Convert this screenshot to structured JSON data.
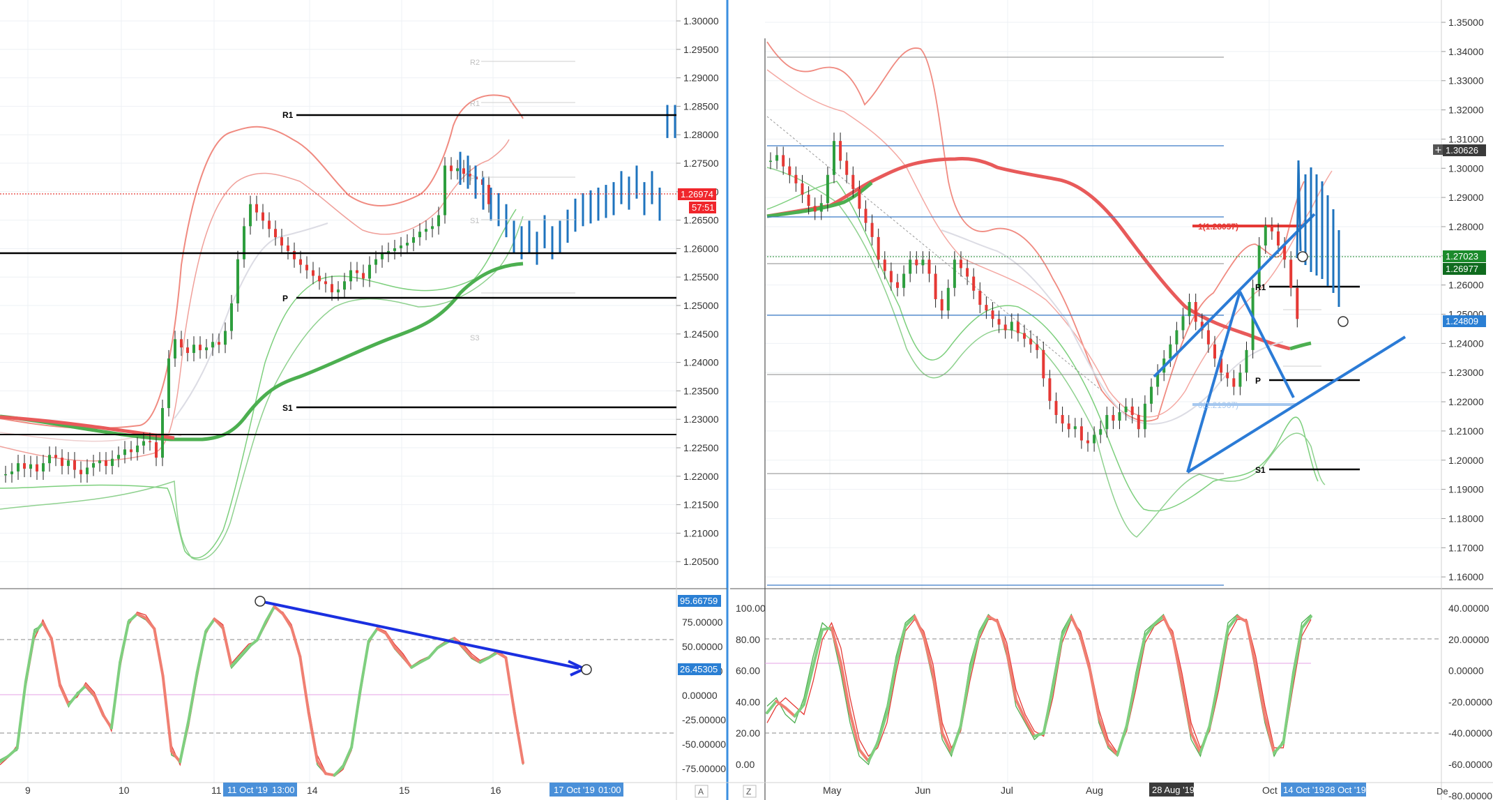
{
  "colors": {
    "up": "#26a69a",
    "up_candle": "#2e9e3e",
    "down": "#e53935",
    "heikin_blue": "#1e73be",
    "bb_upper": "#f08080",
    "bb_lower": "#7ccf7c",
    "ma_red": "#e85a5a",
    "ma_green": "#4caf50",
    "pivot": "#000000",
    "trend_blue": "#2b7bd6",
    "arrow_blue": "#1a2fe0",
    "grid": "#eef1f4",
    "price_tag_red": "#f0262c",
    "price_tag_blue": "#2a7fd4",
    "price_tag_green": "#1b8a2b",
    "stoch_k": "#4caf50",
    "stoch_d": "#e53935",
    "stoch_bold_up": "#7fcf7f",
    "stoch_bold_down": "#f07f72",
    "time_tag": "#4a90d9",
    "date_tag_dark": "#3a3a3a"
  },
  "chart_data": [
    {
      "type": "candlestick",
      "panel": "left-main",
      "y_ticks": [
        "1.30000",
        "1.29500",
        "1.29000",
        "1.28500",
        "1.28000",
        "1.27500",
        "1.27000",
        "1.26500",
        "1.26000",
        "1.25500",
        "1.25000",
        "1.24500",
        "1.24000",
        "1.23500",
        "1.23000",
        "1.22500",
        "1.22000",
        "1.21500",
        "1.21000",
        "1.20500"
      ],
      "ylim": [
        1.2015,
        1.3035
      ],
      "x_ticks": [
        "9",
        "10",
        "11",
        "14",
        "15",
        "16"
      ],
      "price_tags": [
        {
          "label": "1.26974",
          "color": "red"
        },
        {
          "label": "57:51",
          "color": "red"
        }
      ],
      "pivot_levels": [
        {
          "label": "R1",
          "value": 1.2835
        },
        {
          "label": "P",
          "value": 1.2515
        },
        {
          "label": "S1",
          "value": 1.2323
        }
      ],
      "faint_pivots": [
        {
          "label": "R2",
          "value": 1.293
        },
        {
          "label": "R1",
          "value": 1.2855
        },
        {
          "label": "P",
          "value": 1.274
        },
        {
          "label": "S1",
          "value": 1.265
        },
        {
          "label": "S3",
          "value": 1.245
        }
      ],
      "horizontal_lines": [
        1.259,
        1.2275
      ],
      "current_price_line": 1.26974,
      "close_series": [
        1.221,
        1.2215,
        1.223,
        1.222,
        1.2228,
        1.2215,
        1.223,
        1.2245,
        1.224,
        1.2225,
        1.2235,
        1.2218,
        1.221,
        1.2222,
        1.223,
        1.2235,
        1.2225,
        1.2238,
        1.2245,
        1.2255,
        1.225,
        1.2262,
        1.227,
        1.2268,
        1.224,
        1.233,
        1.242,
        1.2455,
        1.244,
        1.243,
        1.2445,
        1.2435,
        1.244,
        1.245,
        1.2445,
        1.247,
        1.252,
        1.26,
        1.266,
        1.27,
        1.2685,
        1.267,
        1.2655,
        1.264,
        1.2625,
        1.2615,
        1.26,
        1.259,
        1.258,
        1.257,
        1.256,
        1.2555,
        1.254,
        1.2545,
        1.256,
        1.258,
        1.2575,
        1.2565,
        1.259,
        1.26,
        1.261,
        1.2615,
        1.262,
        1.2625,
        1.263,
        1.264,
        1.265,
        1.2655,
        1.266,
        1.268,
        1.277,
        1.276,
        1.2765,
        1.2755,
        1.275,
        1.2745,
        1.2735,
        1.27
      ]
    },
    {
      "type": "candlestick",
      "panel": "right-main",
      "y_ticks": [
        "1.35000",
        "1.34000",
        "1.33000",
        "1.32000",
        "1.31000",
        "1.30000",
        "1.29000",
        "1.28000",
        "1.27000",
        "1.26000",
        "1.25000",
        "1.24000",
        "1.23000",
        "1.22000",
        "1.21000",
        "1.20000",
        "1.19000",
        "1.18000",
        "1.17000",
        "1.16000"
      ],
      "ylim": [
        1.156,
        1.3545
      ],
      "x_ticks": [
        "May",
        "Jun",
        "Jul",
        "Aug",
        "Oct"
      ],
      "price_tags": [
        {
          "label": "1.30626",
          "color": "dark"
        },
        {
          "label": "1.27023",
          "color": "green"
        },
        {
          "label": "1.26977",
          "color": "dark-green"
        },
        {
          "label": "1.24809",
          "color": "blue"
        }
      ],
      "pivot_levels": [
        {
          "label": "R1",
          "value": 1.26
        },
        {
          "label": "P",
          "value": 1.228
        },
        {
          "label": "S1",
          "value": 1.1975
        }
      ],
      "fib_labels": [
        {
          "label": "1(1.28057)",
          "value": 1.28057
        },
        {
          "label": "0(1.21967)",
          "value": 1.21967
        }
      ],
      "close_series": [
        1.305,
        1.307,
        1.303,
        1.3,
        1.297,
        1.293,
        1.289,
        1.287,
        1.29,
        1.3,
        1.312,
        1.305,
        1.3,
        1.295,
        1.288,
        1.283,
        1.278,
        1.27,
        1.266,
        1.262,
        1.26,
        1.265,
        1.27,
        1.268,
        1.27,
        1.265,
        1.256,
        1.252,
        1.26,
        1.27,
        1.267,
        1.264,
        1.259,
        1.254,
        1.252,
        1.249,
        1.247,
        1.245,
        1.248,
        1.244,
        1.242,
        1.24,
        1.238,
        1.228,
        1.22,
        1.215,
        1.212,
        1.21,
        1.211,
        1.206,
        1.205,
        1.208,
        1.21,
        1.215,
        1.213,
        1.216,
        1.218,
        1.215,
        1.21,
        1.219,
        1.225,
        1.23,
        1.235,
        1.24,
        1.245,
        1.25,
        1.255,
        1.248,
        1.245,
        1.24,
        1.235,
        1.23,
        1.228,
        1.225,
        1.23,
        1.238,
        1.26,
        1.275,
        1.282,
        1.28,
        1.275,
        1.27,
        1.26,
        1.249
      ]
    },
    {
      "type": "line",
      "panel": "left-oscillator",
      "y_ticks": [
        "75.00000",
        "50.00000",
        "25.00000",
        "0.00000",
        "-25.00000",
        "-50.00000",
        "-75.00000"
      ],
      "ylim": [
        -87,
        108
      ],
      "value_tags": [
        {
          "label": "95.66759"
        },
        {
          "label": "26.45305"
        }
      ],
      "series": [
        {
          "values": [
            -65,
            -60,
            -55,
            20,
            70,
            75,
            60,
            10,
            -10,
            5,
            10,
            0,
            -20,
            -30,
            40,
            80,
            85,
            80,
            70,
            20,
            -60,
            -65,
            -20,
            30,
            70,
            80,
            70,
            30,
            40,
            50,
            60,
            80,
            95,
            85,
            70,
            40,
            -20,
            -70,
            -80,
            -80,
            -70,
            -50,
            10,
            60,
            70,
            65,
            50,
            40,
            30,
            35,
            40,
            50,
            55,
            60,
            50,
            40,
            35,
            40,
            45,
            40,
            -20,
            -70
          ]
        },
        {
          "values": [
            -70,
            -62,
            -50,
            10,
            60,
            80,
            62,
            15,
            -5,
            0,
            15,
            5,
            -15,
            -35,
            30,
            75,
            88,
            85,
            72,
            25,
            -50,
            -70,
            -30,
            20,
            65,
            82,
            75,
            35,
            45,
            55,
            58,
            75,
            92,
            88,
            75,
            45,
            -10,
            -60,
            -78,
            -82,
            -75,
            -55,
            0,
            55,
            72,
            68,
            55,
            45,
            32,
            38,
            42,
            52,
            58,
            62,
            55,
            45,
            38,
            42,
            48,
            42,
            -10,
            -65
          ]
        }
      ]
    },
    {
      "type": "line",
      "panel": "right-oscillator",
      "y_ticks_left": [
        "100.00",
        "80.00",
        "60.00",
        "40.00",
        "20.00",
        "0.00"
      ],
      "y_ticks_right": [
        "40.00000",
        "20.00000",
        "0.00000",
        "-20.00000",
        "-40.00000",
        "-60.00000",
        "-80.00000"
      ],
      "ylim": [
        -5,
        108
      ],
      "series": [
        {
          "values": [
            40,
            45,
            35,
            30,
            45,
            70,
            90,
            85,
            60,
            30,
            10,
            5,
            20,
            40,
            70,
            90,
            95,
            80,
            55,
            20,
            10,
            30,
            65,
            85,
            95,
            90,
            70,
            40,
            30,
            20,
            25,
            55,
            85,
            95,
            80,
            60,
            30,
            15,
            10,
            30,
            60,
            85,
            90,
            95,
            80,
            50,
            20,
            10,
            30,
            60,
            90,
            95,
            90,
            60,
            30,
            10,
            20,
            60,
            90,
            95
          ]
        },
        {
          "values": [
            30,
            40,
            45,
            40,
            35,
            55,
            80,
            90,
            75,
            45,
            20,
            10,
            15,
            30,
            60,
            85,
            92,
            85,
            65,
            30,
            15,
            25,
            55,
            80,
            92,
            92,
            78,
            50,
            35,
            25,
            22,
            45,
            78,
            92,
            85,
            65,
            38,
            20,
            12,
            25,
            50,
            78,
            88,
            92,
            85,
            60,
            30,
            15,
            25,
            50,
            82,
            92,
            92,
            70,
            40,
            15,
            15,
            50,
            82,
            92
          ]
        }
      ]
    }
  ],
  "time_tags": [
    {
      "label": "11 Oct '19"
    },
    {
      "label": "13:00"
    },
    {
      "label": "17 Oct '19"
    },
    {
      "label": "01:00"
    },
    {
      "label": "28 Aug '19"
    },
    {
      "label": "14 Oct '19"
    },
    {
      "label": "28 Oct '19"
    }
  ],
  "axis_buttons": {
    "left_auto": "A",
    "right_z": "Z",
    "right_de": "De"
  }
}
